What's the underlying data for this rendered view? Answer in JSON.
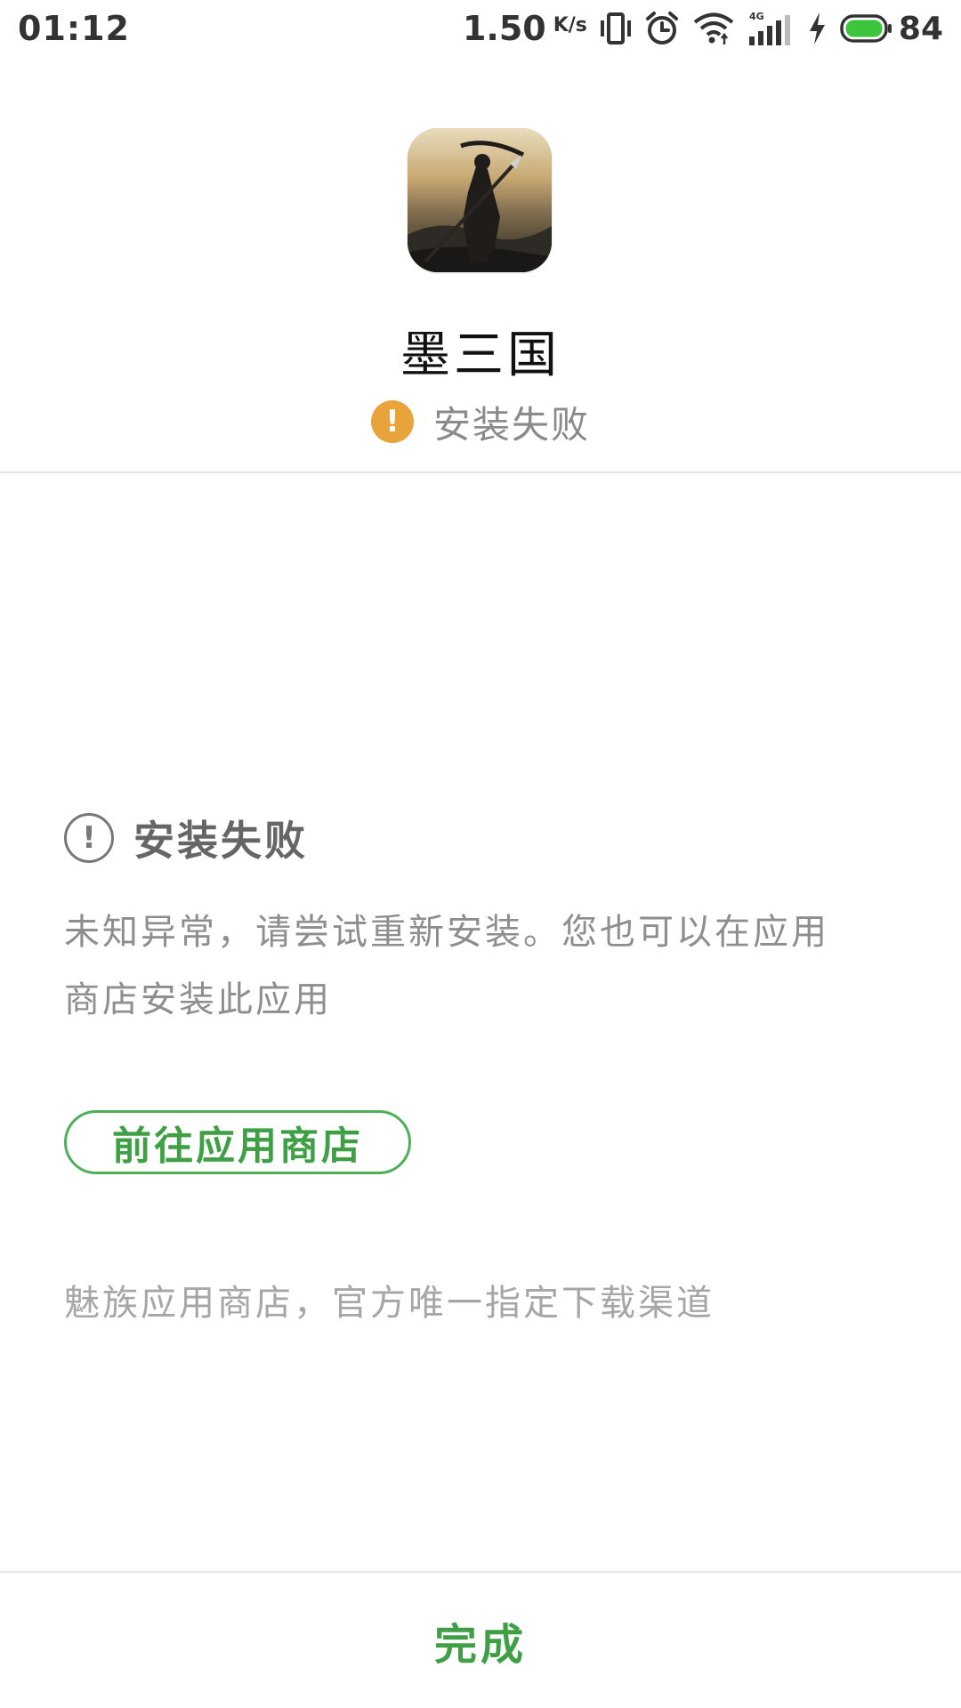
{
  "status_bar": {
    "time": "01:12",
    "net_speed": "1.50",
    "net_speed_unit": "K/s",
    "network_type": "4G",
    "battery_percent": "84",
    "icons": [
      "vibrate-icon",
      "alarm-icon",
      "wifi-icon",
      "signal-4g-icon",
      "charging-icon",
      "battery-icon"
    ]
  },
  "header": {
    "app_name": "墨三国",
    "status_badge": "!",
    "status_text": "安装失败"
  },
  "body": {
    "fail_icon": "!",
    "fail_title": "安装失败",
    "fail_desc_line1": "未知异常，请尝试重新安装。您也可以在应用",
    "fail_desc_line2": "商店安装此应用",
    "store_button_label": "前往应用商店",
    "official_note": "魅族应用商店，官方唯一指定下载渠道"
  },
  "footer": {
    "done_label": "完成"
  },
  "colors": {
    "accent_green": "#3e9f45",
    "warning_orange": "#e8a33a",
    "battery_green": "#3cc43c"
  }
}
